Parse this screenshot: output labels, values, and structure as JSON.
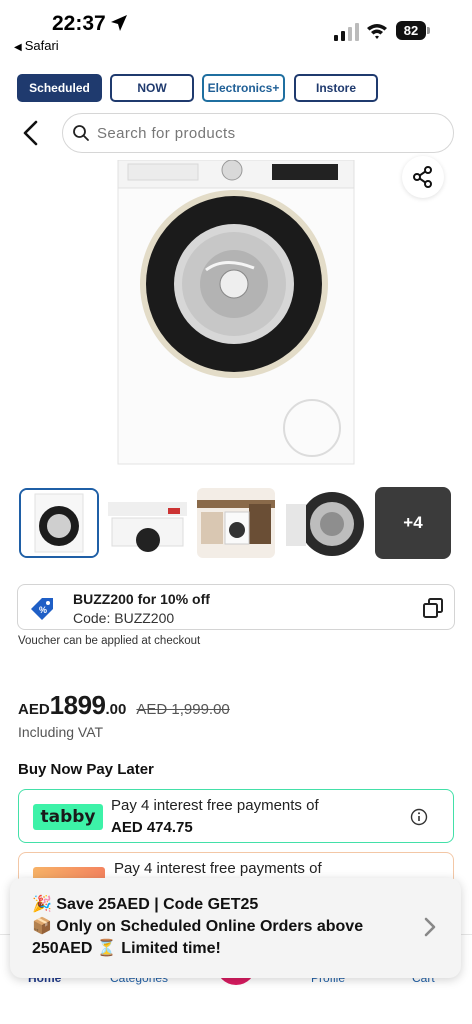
{
  "status_bar": {
    "time": "22:37",
    "back_app": "Safari",
    "battery": "82"
  },
  "tabs": [
    {
      "label": "Scheduled",
      "active": true
    },
    {
      "label": "NOW",
      "active": false
    },
    {
      "label": "Electronics+",
      "active": false
    },
    {
      "label": "Instore",
      "active": false
    }
  ],
  "search": {
    "placeholder": "Search for products"
  },
  "gallery": {
    "more_label": "+4"
  },
  "voucher": {
    "title": "BUZZ200 for 10% off",
    "code": "Code: BUZZ200",
    "note": "Voucher can be applied at checkout"
  },
  "price": {
    "currency": "AED",
    "integer": "1899",
    "decimal": ".00",
    "old": "AED 1,999.00",
    "vat_note": "Including VAT"
  },
  "bnpl": {
    "title": "Buy Now Pay Later",
    "tabby": {
      "logo": "tabby",
      "line1": "Pay 4 interest free payments of",
      "line2": "AED 474.75"
    },
    "tamara": {
      "line1": "Pay 4 interest free payments of"
    }
  },
  "promo": {
    "line1": "🎉 Save 25AED | Code GET25",
    "line2": "📦 Only on Scheduled Online Orders above 250AED ⏳ Limited time!"
  },
  "bottom_nav": [
    {
      "label": "Home",
      "active": true
    },
    {
      "label": "Categories",
      "active": false
    },
    {
      "label": "Profile",
      "active": false
    },
    {
      "label": "Cart",
      "active": false
    }
  ],
  "colors": {
    "brand_navy": "#1f3a6e",
    "tabby_green": "#3df2a8",
    "accent_pink": "#d81b60"
  },
  "icons": [
    "location-arrow-icon",
    "signal-icon",
    "wifi-icon",
    "battery-icon",
    "back-chevron-icon",
    "search-icon",
    "share-icon",
    "voucher-tag-icon",
    "copy-icon",
    "info-icon",
    "chevron-right-icon"
  ]
}
